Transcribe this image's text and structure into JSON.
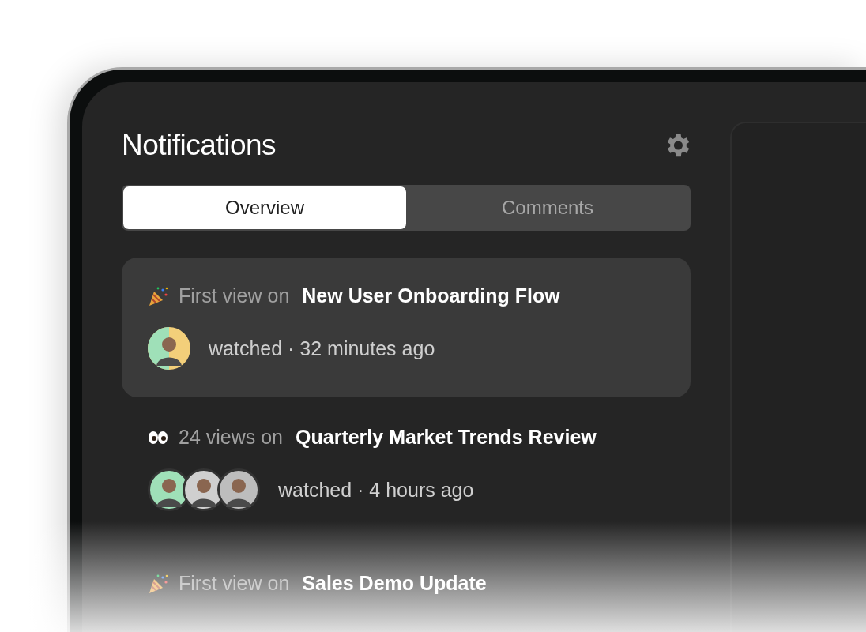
{
  "panel": {
    "title": "Notifications"
  },
  "tabs": [
    {
      "label": "Overview",
      "selected": true
    },
    {
      "label": "Comments",
      "selected": false
    }
  ],
  "notifications": [
    {
      "kind": "first_view",
      "selected": true,
      "lead": "First view on",
      "item": "New User Onboarding Flow",
      "avatars": [
        {
          "kind": "person"
        }
      ],
      "meta": "watched · 32 minutes ago"
    },
    {
      "kind": "views",
      "selected": false,
      "lead": "24 views on",
      "item": "Quarterly Market Trends Review",
      "avatars": [
        {
          "kind": "person"
        },
        {
          "kind": "person"
        },
        {
          "kind": "person"
        }
      ],
      "meta": "watched · 4 hours ago"
    },
    {
      "kind": "first_view",
      "selected": false,
      "lead": "First view on",
      "item": "Sales Demo Update"
    }
  ]
}
